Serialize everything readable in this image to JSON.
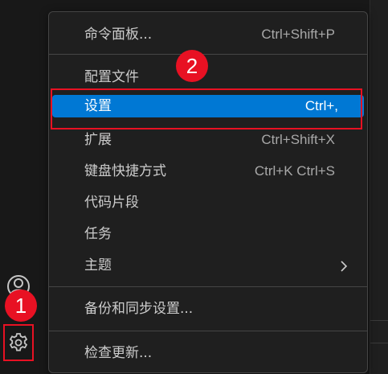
{
  "menu": {
    "items": [
      {
        "label": "命令面板...",
        "shortcut": "Ctrl+Shift+P"
      },
      {
        "label": "配置文件",
        "shortcut": ""
      },
      {
        "label": "设置",
        "shortcut": "Ctrl+,"
      },
      {
        "label": "扩展",
        "shortcut": "Ctrl+Shift+X"
      },
      {
        "label": "键盘快捷方式",
        "shortcut": "Ctrl+K Ctrl+S"
      },
      {
        "label": "代码片段",
        "shortcut": ""
      },
      {
        "label": "任务",
        "shortcut": ""
      },
      {
        "label": "主题",
        "shortcut": ""
      },
      {
        "label": "备份和同步设置...",
        "shortcut": ""
      },
      {
        "label": "检查更新...",
        "shortcut": ""
      }
    ],
    "active_index": 2
  },
  "annotations": {
    "badge_1": "1",
    "badge_2": "2"
  },
  "colors": {
    "accent": "#0078d4",
    "annotation": "#e81123",
    "menu_bg": "#1f1f1f",
    "text": "#cccccc"
  },
  "icons": {
    "account": "account-icon",
    "settings": "gear-icon",
    "submenu": "chevron-right-icon"
  }
}
